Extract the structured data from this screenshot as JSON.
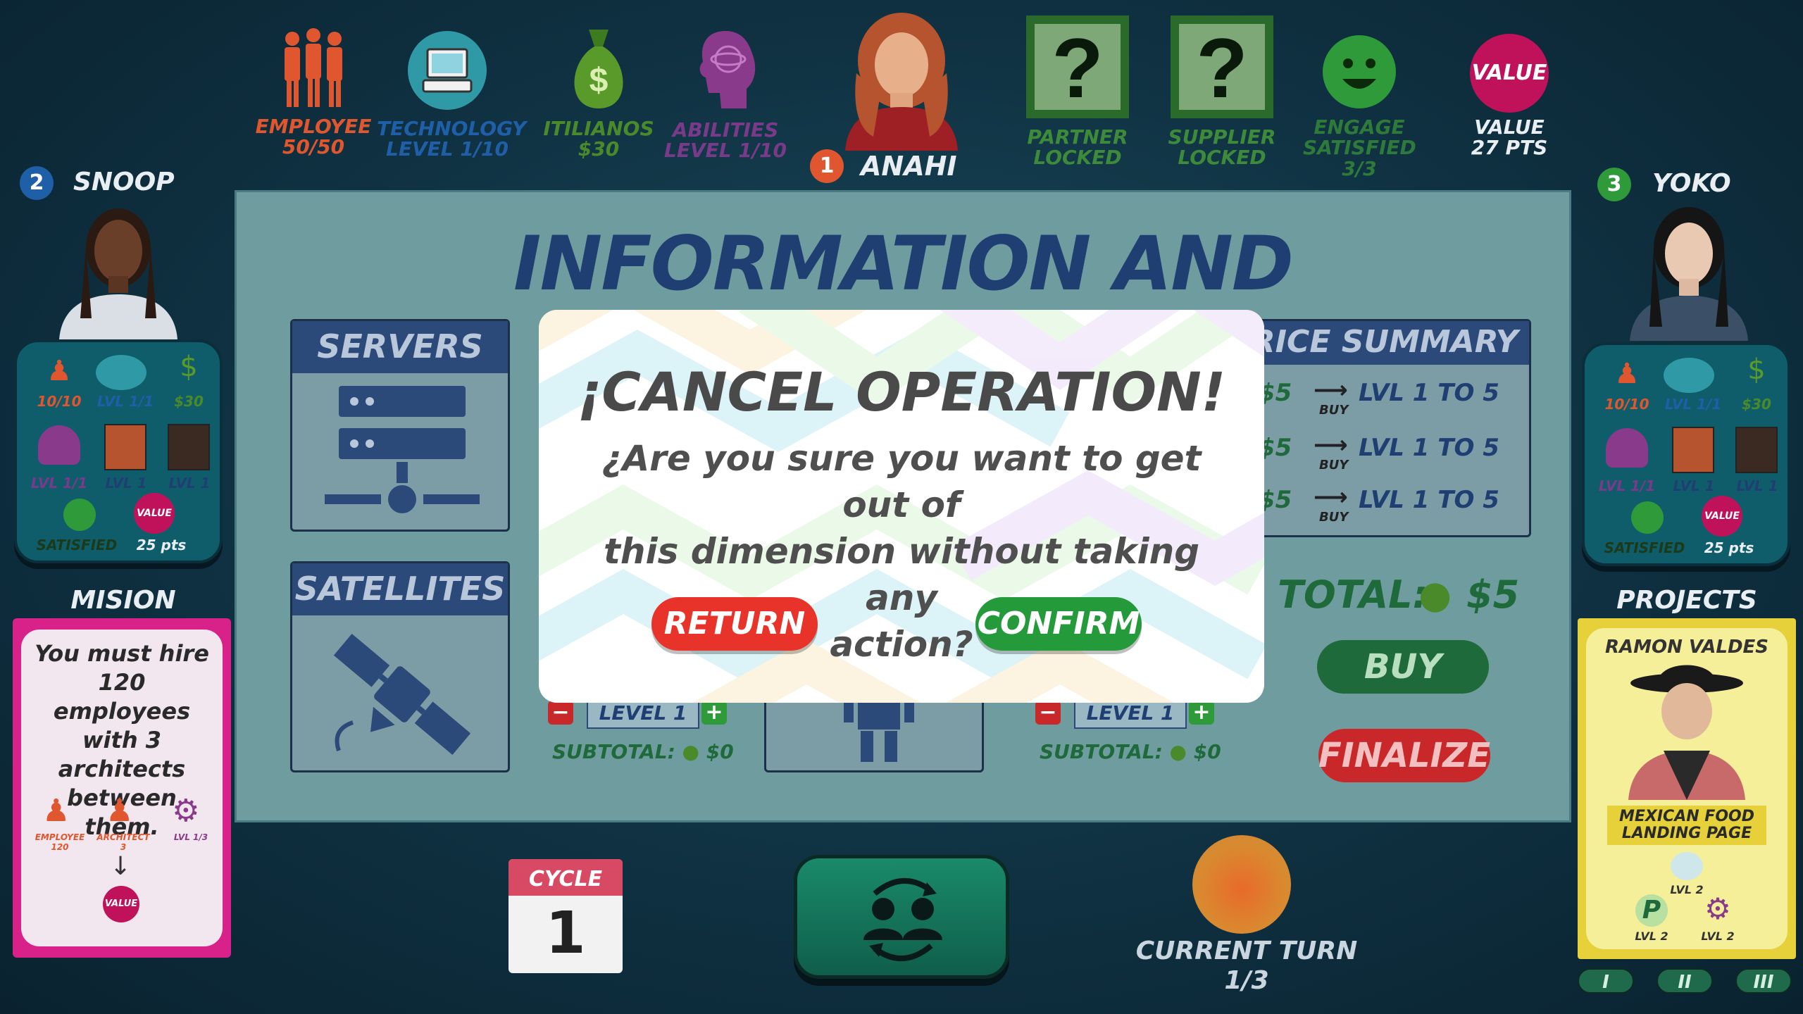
{
  "top_stats": {
    "employee": {
      "label": "EMPLOYEE",
      "value": "50/50",
      "color": "#e0562e"
    },
    "technology": {
      "label": "TECHNOLOGY",
      "value": "LEVEL  1/10",
      "color": "#1f5fa8"
    },
    "itilianos": {
      "label": "ITILIANOS",
      "value": "$30",
      "color": "#4a8a2a"
    },
    "abilities": {
      "label": "ABILITIES",
      "value": "LEVEL  1/10",
      "color": "#7a3a8a"
    },
    "current_player": {
      "number": "1",
      "name": "ANAHI"
    },
    "partner": {
      "label": "PARTNER",
      "value": "LOCKED"
    },
    "supplier": {
      "label": "SUPPLIER",
      "value": "LOCKED"
    },
    "engage": {
      "label": "ENGAGE",
      "label2": "SATISFIED",
      "value": "3/3"
    },
    "value_stat": {
      "badge": "VALUE",
      "label": "VALUE",
      "value": "27 PTS"
    }
  },
  "left_player": {
    "number": "2",
    "name": "SNOOP",
    "stats": {
      "employees": "10/10",
      "tech": "LVL 1/1",
      "money": "$30",
      "abilities": "LVL 1/1",
      "char1": "LVL 1",
      "char2": "LVL 1",
      "satisfied": "SATISFIED",
      "value_badge": "VALUE",
      "pts": "25 pts"
    }
  },
  "right_player": {
    "number": "3",
    "name": "YOKO",
    "stats": {
      "employees": "10/10",
      "tech": "LVL 1/1",
      "money": "$30",
      "abilities": "LVL 1/1",
      "char1": "LVL 1",
      "char2": "LVL 1",
      "satisfied": "SATISFIED",
      "value_badge": "VALUE",
      "pts": "25 pts"
    }
  },
  "mission": {
    "header": "MISION",
    "text": "You must hire 120 employees with 3 architects between them.",
    "icon_labels": {
      "employee": "EMPLOYEE",
      "employee_count": "120",
      "architect": "ARCHITECT",
      "architect_count": "3",
      "level": "LVL 1/3",
      "value": "VALUE"
    }
  },
  "projects": {
    "header": "PROJECTS",
    "card_name": "RAMON VALDES",
    "card_project": "MEXICAN FOOD LANDING PAGE",
    "req1": "LVL 2",
    "req2": "LVL 2",
    "req3": "LVL 2",
    "pages": [
      "I",
      "II",
      "III"
    ]
  },
  "board": {
    "title": "INFORMATION AND TECHNOLOGY",
    "servers": "SERVERS",
    "satellites": "SATELLITES",
    "price_summary": "PRICE SUMMARY",
    "prices": [
      {
        "price": "$5",
        "action": "BUY",
        "range": "LVL 1 TO 5"
      },
      {
        "price": "$5",
        "action": "BUY",
        "range": "LVL 1 TO 5"
      },
      {
        "price": "$5",
        "action": "BUY",
        "range": "LVL 1 TO 5"
      }
    ],
    "level_a": "LEVEL 1",
    "level_b": "LEVEL 1",
    "subtotal_a_label": "SUBTOTAL:",
    "subtotal_a_value": "$0",
    "subtotal_b_label": "SUBTOTAL:",
    "subtotal_b_value": "$0",
    "total_label": "TOTAL:",
    "total_value": "$5",
    "buy": "BUY",
    "finalize": "FINALIZE"
  },
  "modal": {
    "title": "¡CANCEL OPERATION!",
    "message_line1": "¿Are you sure you want to get out of",
    "message_line2": "this dimension without taking any",
    "message_line3": "action?",
    "return": "RETURN",
    "confirm": "CONFIRM"
  },
  "bottom": {
    "cycle_label": "CYCLE",
    "cycle_value": "1",
    "current_turn_label": "CURRENT TURN",
    "current_turn_value": "1/3"
  },
  "colors": {
    "board_title": "#1f3f73",
    "return_btn": "#e8332a",
    "confirm_btn": "#259a3a",
    "buy_btn": "#1f6a3a",
    "finalize_btn": "#c8282a",
    "mission_card": "#d8228a",
    "project_card": "#e6d13a"
  }
}
